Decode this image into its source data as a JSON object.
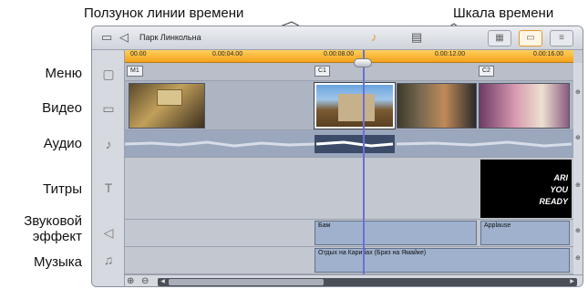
{
  "callouts": {
    "scrubber": "Ползунок линии времени",
    "ruler": "Шкала времени"
  },
  "track_labels": [
    {
      "id": "menu",
      "text": "Меню"
    },
    {
      "id": "video",
      "text": "Видео"
    },
    {
      "id": "audio",
      "text": "Аудио"
    },
    {
      "id": "titles",
      "text": "Титры"
    },
    {
      "id": "sfx",
      "text": "Звуковой\nэффект"
    },
    {
      "id": "music",
      "text": "Музыка"
    }
  ],
  "toolbar": {
    "project_name": "Парк Линкольна",
    "icons": [
      "film-icon",
      "speaker-icon",
      "audio-sync-icon",
      "markers-icon",
      "storyboard-view-icon",
      "timeline-view-icon",
      "text-view-icon"
    ]
  },
  "ruler": {
    "ticks": [
      "00.00",
      "0.00:04.00",
      "0.00:08.00",
      "0.00:12.00",
      "0.00:16.00"
    ]
  },
  "menu_track": {
    "markers": [
      "M1",
      "C1",
      "C2"
    ]
  },
  "sfx_track": {
    "clips": [
      "Бам",
      "Applause"
    ]
  },
  "music_track": {
    "clips": [
      "Отдых на Карибах (Бриз на Ямайке)"
    ]
  },
  "title_clip": {
    "lines": [
      "ARI",
      "YOU",
      "READY"
    ]
  },
  "colors": {
    "accent_orange": "#f3a21b",
    "scrubber_blue": "#6a6fd8",
    "track_bg": "#c3c7cf",
    "audio_clip": "#9fb1cc"
  }
}
